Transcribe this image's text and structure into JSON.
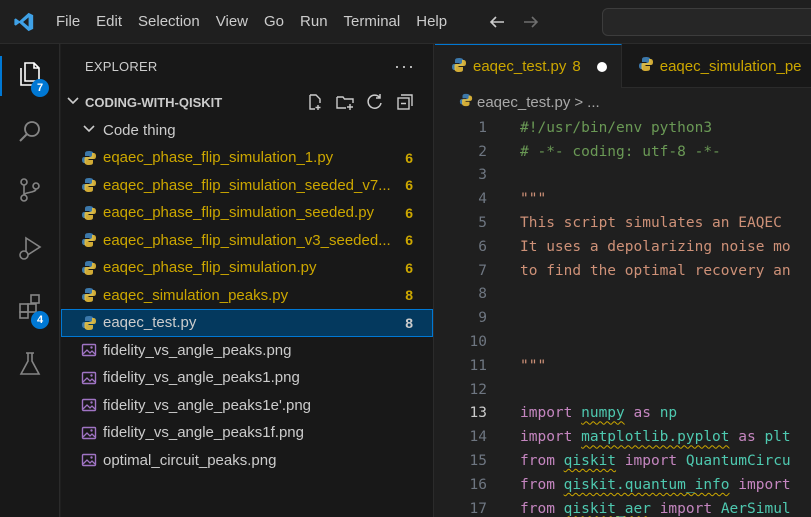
{
  "menu": [
    "File",
    "Edit",
    "Selection",
    "View",
    "Go",
    "Run",
    "Terminal",
    "Help"
  ],
  "activity": {
    "explorer_badge": "7",
    "extensions_badge": "4"
  },
  "explorer": {
    "title": "EXPLORER",
    "more": "···",
    "folder": "CODING-WITH-QISKIT",
    "subfolder": "Code thing",
    "files": [
      {
        "name": "eqaec_phase_flip_simulation_1.py",
        "count": "6",
        "type": "python",
        "state": "warning"
      },
      {
        "name": "eaqec_phase_flip_simulation_seeded_v7...",
        "count": "6",
        "type": "python",
        "state": "warning"
      },
      {
        "name": "eaqec_phase_flip_simulation_seeded.py",
        "count": "6",
        "type": "python",
        "state": "warning"
      },
      {
        "name": "eaqec_phase_flip_simulation_v3_seeded...",
        "count": "6",
        "type": "python",
        "state": "warning"
      },
      {
        "name": "eaqec_phase_flip_simulation.py",
        "count": "6",
        "type": "python",
        "state": "warning"
      },
      {
        "name": "eaqec_simulation_peaks.py",
        "count": "8",
        "type": "python",
        "state": "warning"
      },
      {
        "name": "eaqec_test.py",
        "count": "8",
        "type": "python",
        "state": "selected"
      },
      {
        "name": "fidelity_vs_angle_peaks.png",
        "count": "",
        "type": "image",
        "state": "normal"
      },
      {
        "name": "fidelity_vs_angle_peaks1.png",
        "count": "",
        "type": "image",
        "state": "normal"
      },
      {
        "name": "fidelity_vs_angle_peaks1e'.png",
        "count": "",
        "type": "image",
        "state": "normal"
      },
      {
        "name": "fidelity_vs_angle_peaks1f.png",
        "count": "",
        "type": "image",
        "state": "normal"
      },
      {
        "name": "optimal_circuit_peaks.png",
        "count": "",
        "type": "image",
        "state": "normal"
      }
    ]
  },
  "tabs": [
    {
      "label": "eaqec_test.py",
      "count": "8",
      "active": true,
      "dirty": true
    },
    {
      "label": "eaqec_simulation_pe",
      "count": "",
      "active": false,
      "dirty": false
    }
  ],
  "breadcrumb": {
    "file": "eaqec_test.py",
    "sep": ">",
    "rest": "..."
  },
  "code": [
    {
      "n": "1",
      "tokens": [
        {
          "t": "#!/usr/bin/env python3",
          "c": "c-comment"
        }
      ]
    },
    {
      "n": "2",
      "tokens": [
        {
          "t": "# -*- coding: utf-8 -*-",
          "c": "c-comment"
        }
      ]
    },
    {
      "n": "3",
      "tokens": []
    },
    {
      "n": "4",
      "tokens": [
        {
          "t": "\"\"\"",
          "c": "c-string"
        }
      ]
    },
    {
      "n": "5",
      "tokens": [
        {
          "t": "This script simulates an EAQEC",
          "c": "c-string"
        }
      ]
    },
    {
      "n": "6",
      "tokens": [
        {
          "t": "It uses a depolarizing noise mo",
          "c": "c-string"
        }
      ]
    },
    {
      "n": "7",
      "tokens": [
        {
          "t": "to find the optimal recovery an",
          "c": "c-string"
        }
      ]
    },
    {
      "n": "8",
      "tokens": []
    },
    {
      "n": "9",
      "tokens": []
    },
    {
      "n": "10",
      "tokens": []
    },
    {
      "n": "11",
      "tokens": [
        {
          "t": "\"\"\"",
          "c": "c-string"
        }
      ]
    },
    {
      "n": "12",
      "tokens": []
    },
    {
      "n": "13",
      "tokens": [
        {
          "t": "import ",
          "c": "c-kw"
        },
        {
          "t": "numpy",
          "c": "c-mod squiggle"
        },
        {
          "t": " as ",
          "c": "c-kw"
        },
        {
          "t": "np",
          "c": "c-mod"
        }
      ]
    },
    {
      "n": "14",
      "tokens": [
        {
          "t": "import ",
          "c": "c-kw"
        },
        {
          "t": "matplotlib.pyplot",
          "c": "c-mod squiggle"
        },
        {
          "t": " as ",
          "c": "c-kw"
        },
        {
          "t": "plt",
          "c": "c-mod"
        }
      ]
    },
    {
      "n": "15",
      "tokens": [
        {
          "t": "from ",
          "c": "c-kw"
        },
        {
          "t": "qiskit",
          "c": "c-mod squiggle"
        },
        {
          "t": " import ",
          "c": "c-kw"
        },
        {
          "t": "QuantumCircu",
          "c": "c-mod"
        }
      ]
    },
    {
      "n": "16",
      "tokens": [
        {
          "t": "from ",
          "c": "c-kw"
        },
        {
          "t": "qiskit.quantum_info",
          "c": "c-mod squiggle"
        },
        {
          "t": " import",
          "c": "c-kw"
        }
      ]
    },
    {
      "n": "17",
      "tokens": [
        {
          "t": "from ",
          "c": "c-kw"
        },
        {
          "t": "qiskit_aer",
          "c": "c-mod squiggle"
        },
        {
          "t": " import ",
          "c": "c-kw"
        },
        {
          "t": "AerSimul",
          "c": "c-mod"
        }
      ]
    }
  ],
  "current_line": "13",
  "colors": {
    "accent": "#0078d4",
    "warning": "#cca700",
    "selection": "#04395e"
  }
}
